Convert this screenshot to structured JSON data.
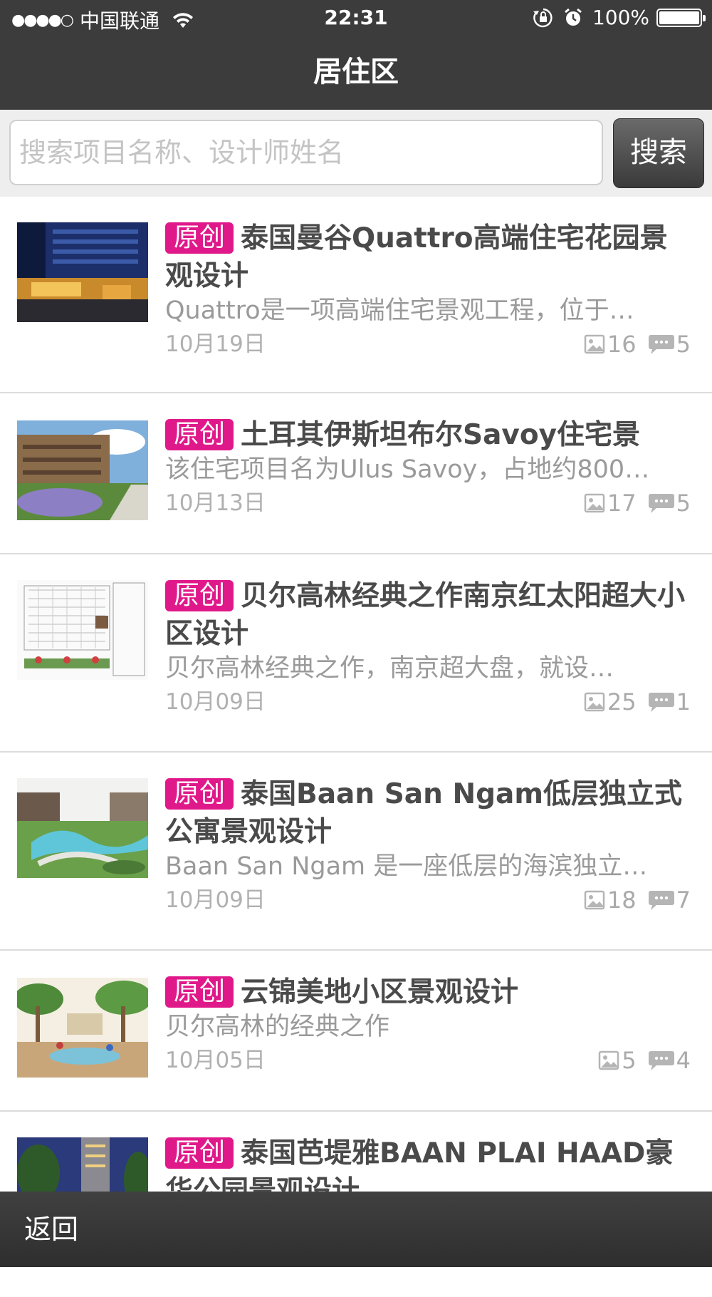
{
  "status_bar": {
    "signal": "●●●●○",
    "carrier": "中国联通",
    "time": "22:31",
    "battery_percent": "100%",
    "battery_level": 1.0,
    "icons": [
      "wifi-icon",
      "rotation-lock-icon",
      "alarm-icon",
      "battery-icon"
    ]
  },
  "nav": {
    "title": "居住区"
  },
  "search": {
    "placeholder": "搜索项目名称、设计师姓名",
    "button_label": "搜索"
  },
  "badge_label": "原创",
  "items": [
    {
      "title": "泰国曼谷Quattro高端住宅花园景观设计",
      "desc": "Quattro是一项高端住宅景观工程，位于…",
      "date": "10月19日",
      "images": "16",
      "comments": "5",
      "thumb": "night-building-photo"
    },
    {
      "title": "土耳其伊斯坦布尔Savoy住宅景",
      "desc": "该住宅项目名为Ulus Savoy，占地约800…",
      "date": "10月13日",
      "images": "17",
      "comments": "5",
      "thumb": "garden-building-photo"
    },
    {
      "title": "贝尔高林经典之作南京红太阳超大小区设计",
      "desc": "贝尔高林经典之作，南京超大盘，就设…",
      "date": "10月09日",
      "images": "25",
      "comments": "1",
      "thumb": "site-plan-drawing"
    },
    {
      "title": "泰国Baan San Ngam低层独立式公寓景观设计",
      "desc": "Baan San Ngam 是一座低层的海滨独立…",
      "date": "10月09日",
      "images": "18",
      "comments": "7",
      "thumb": "pool-aerial-render"
    },
    {
      "title": "云锦美地小区景观设计",
      "desc": "贝尔高林的经典之作",
      "date": "10月05日",
      "images": "5",
      "comments": "4",
      "thumb": "park-watercolor-render"
    },
    {
      "title": "泰国芭堤雅BAAN PLAI HAAD豪华公园景观设计",
      "desc": "",
      "date": "",
      "images": "",
      "comments": "",
      "thumb": "tower-dusk-photo"
    }
  ],
  "bottom_bar": {
    "back_label": "返回"
  },
  "colors": {
    "bar": "#3c3c3c",
    "badge": "#e0198a",
    "text": "#4a4a4a",
    "muted": "#9a9a9a"
  }
}
